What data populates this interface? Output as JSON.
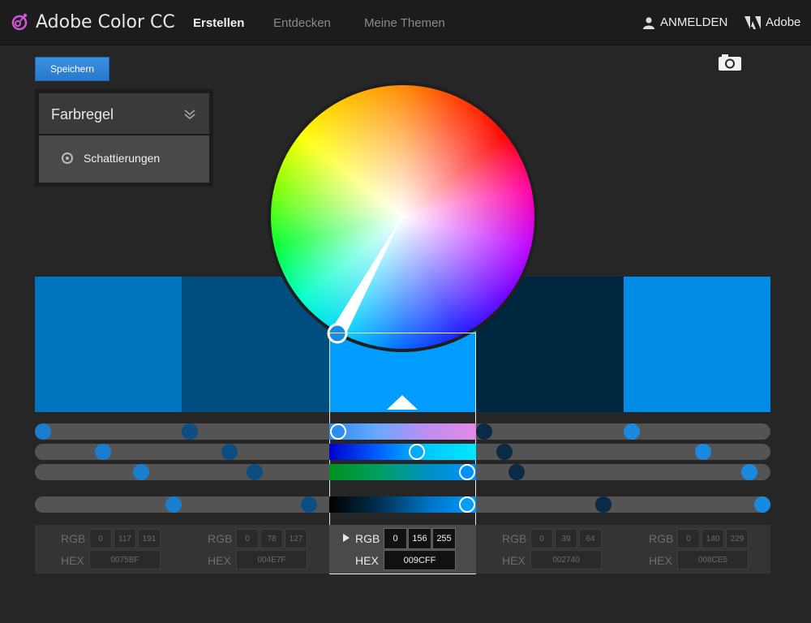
{
  "header": {
    "title": "Adobe Color CC",
    "nav": [
      "Erstellen",
      "Entdecken",
      "Meine Themen"
    ],
    "signin_label": "ANMELDEN",
    "adobe_label": "Adobe"
  },
  "toolbar": {
    "save_label": "Speichern"
  },
  "rule": {
    "title": "Farbregel",
    "option": "Schattierungen"
  },
  "labels": {
    "rgb": "RGB",
    "hex": "HEX"
  },
  "swatches": [
    {
      "color": "#0075BF",
      "r": "0",
      "g": "117",
      "b": "191",
      "hex": "0075BF"
    },
    {
      "color": "#004E7F",
      "r": "0",
      "g": "78",
      "b": "127",
      "hex": "004E7F"
    },
    {
      "color": "#009CFF",
      "r": "0",
      "g": "156",
      "b": "255",
      "hex": "009CFF"
    },
    {
      "color": "#002740",
      "r": "0",
      "g": "39",
      "b": "64",
      "hex": "002740"
    },
    {
      "color": "#008CE5",
      "r": "0",
      "g": "140",
      "b": "229",
      "hex": "008CE5"
    }
  ],
  "active_swatch_index": 2,
  "accent": "#2a78cc"
}
